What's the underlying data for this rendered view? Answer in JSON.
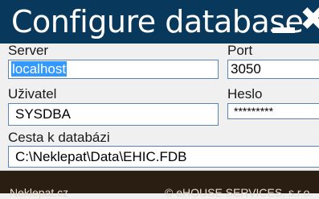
{
  "window": {
    "title": "Configure database",
    "minimize_icon": "minimize-icon",
    "close_icon": "close-icon",
    "close_glyph": "✖"
  },
  "form": {
    "server": {
      "label": "Server",
      "value": "localhost"
    },
    "port": {
      "label": "Port",
      "value": "3050"
    },
    "user": {
      "label": "Uživatel",
      "value": "SYSDBA"
    },
    "password": {
      "label": "Heslo",
      "value": "*********"
    },
    "path": {
      "label": "Cesta k databázi",
      "value": "C:\\Neklepat\\Data\\EHIC.FDB"
    }
  },
  "footer": {
    "left": "Neklepat.cz",
    "right": "© eHOUSE SERVICES, s.r.o."
  },
  "colors": {
    "titlebar": "#08385b",
    "footer": "#2a1d11",
    "selection": "#3399ff",
    "field_border": "#5a84b4"
  }
}
